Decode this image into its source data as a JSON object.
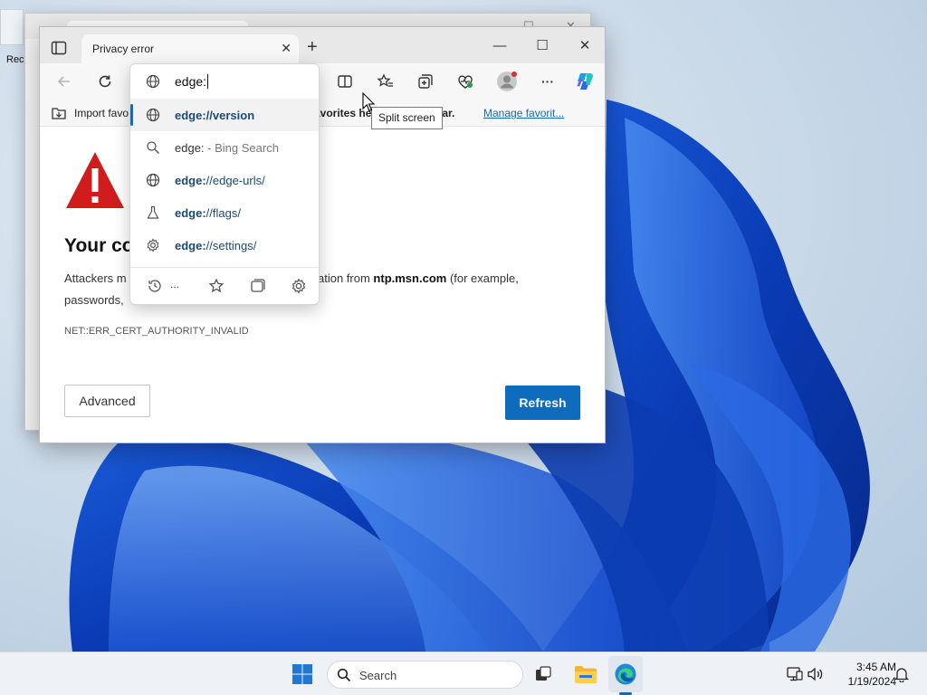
{
  "desktop": {
    "icon_label": "Rec"
  },
  "browser": {
    "tab": {
      "title": "Privacy error",
      "close_glyph": "✕"
    },
    "new_tab_glyph": "+",
    "window_controls": {
      "minimize": "—",
      "maximize": "☐",
      "close": "✕"
    },
    "toolbar": {
      "more_glyph": "···"
    },
    "favorites_bar": {
      "import_label": "Import favo",
      "hint_part1": "avorites her",
      "hint_part2": "ites bar.",
      "manage_link": "Manage favorit..."
    },
    "error_page": {
      "heading_left": "Your co",
      "heading_right": "te",
      "body_left": "Attackers m",
      "body_mid": "ation from ",
      "body_domain": "ntp.msn.com",
      "body_right": " (for example,",
      "body_line2": "passwords,",
      "error_code": "NET::ERR_CERT_AUTHORITY_INVALID",
      "advanced_button": "Advanced",
      "refresh_button": "Refresh"
    }
  },
  "address_dropdown": {
    "input_value": "edge:",
    "suggestions": [
      {
        "icon": "globe-icon",
        "match": "edge:",
        "rest": "//version",
        "bold_all": true
      },
      {
        "icon": "search-icon",
        "match": "edge:",
        "suffix": " - Bing Search"
      },
      {
        "icon": "globe-icon",
        "match": "edge:",
        "rest": "//edge-urls/"
      },
      {
        "icon": "flask-icon",
        "match": "edge:",
        "rest": "//flags/"
      },
      {
        "icon": "gear-icon",
        "match": "edge:",
        "rest": "//settings/"
      }
    ],
    "footer_dots": "..."
  },
  "tooltip": {
    "text": "Split screen"
  },
  "taskbar": {
    "search_placeholder": "Search",
    "time": "3:45 AM",
    "date": "1/19/2024"
  },
  "colors": {
    "accent": "#0f6cbd",
    "warning_red": "#d01c1c",
    "link_blue": "#1a4a78"
  }
}
